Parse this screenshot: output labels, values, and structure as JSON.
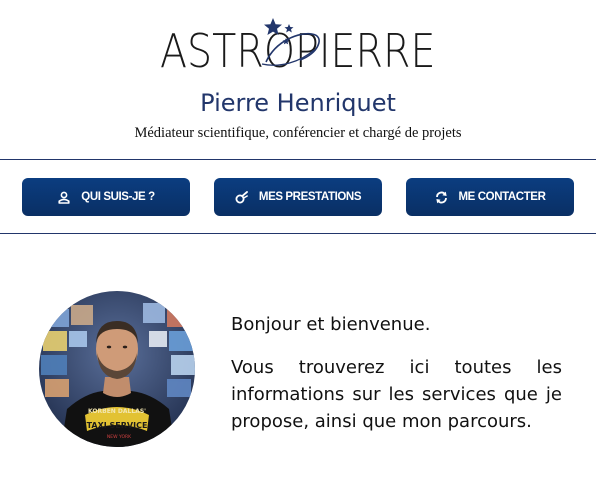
{
  "header": {
    "logo_text": "ASTROPIERRE",
    "name": "Pierre Henriquet",
    "tagline": "Médiateur scientifique, conférencier et chargé de projets"
  },
  "nav": {
    "items": [
      {
        "label": "QUI SUIS-JE ?",
        "icon": "user-icon"
      },
      {
        "label": "MES PRESTATIONS",
        "icon": "comet-icon"
      },
      {
        "label": "ME CONTACTER",
        "icon": "refresh-arrows-icon"
      }
    ]
  },
  "intro": {
    "greeting": "Bonjour et bienvenue.",
    "description": "Vous trouverez ici toutes les informations sur les services que je propose, ainsi que mon parcours.",
    "avatar_shirt_text_1": "KORBEN DALLAS'",
    "avatar_shirt_text_2": "TAXI SERVICE",
    "avatar_shirt_text_3": "NEW YORK"
  },
  "colors": {
    "brand_navy": "#22366b",
    "button_blue": "#0a3570",
    "text": "#111111",
    "background": "#ffffff"
  }
}
